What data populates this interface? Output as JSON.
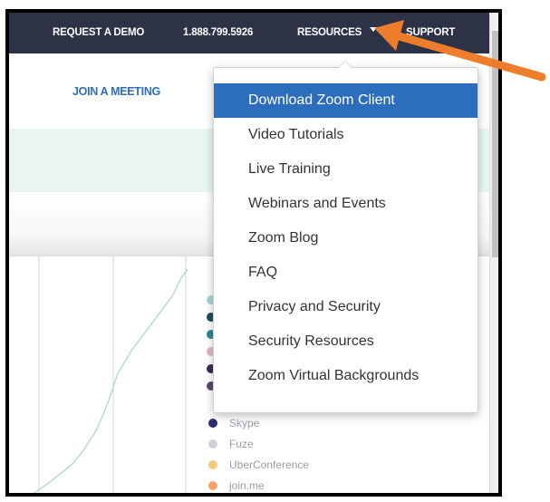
{
  "topbar": {
    "request_demo": "REQUEST A DEMO",
    "phone": "1.888.799.5926",
    "resources": "RESOURCES",
    "support": "SUPPORT"
  },
  "nav": {
    "join_meeting": "JOIN A MEETING"
  },
  "dropdown": {
    "items": [
      "Download Zoom Client",
      "Video Tutorials",
      "Live Training",
      "Webinars and Events",
      "Zoom Blog",
      "FAQ",
      "Privacy and Security",
      "Security Resources",
      "Zoom Virtual Backgrounds"
    ],
    "active_index": 0
  },
  "legend": {
    "items": [
      {
        "label": "Skype",
        "color": "#2a2f6e"
      },
      {
        "label": "Fuze",
        "color": "#d0d0d8"
      },
      {
        "label": "UberConference",
        "color": "#f5c97a"
      },
      {
        "label": "join.me",
        "color": "#f0a36a"
      }
    ],
    "hidden_dot_colors": [
      "#a9d7cf",
      "#1e4d5a",
      "#2a8c8f",
      "#e6b6c0",
      "#3c2d55",
      "#5a4a73"
    ]
  },
  "colors": {
    "topbar_bg": "#2e3247",
    "accent": "#2d6dbd",
    "annotation_arrow": "#ee7d2b",
    "chart_line": "#a9d7cf"
  },
  "annotation": {
    "arrow_icon": "orange-arrow-icon"
  }
}
